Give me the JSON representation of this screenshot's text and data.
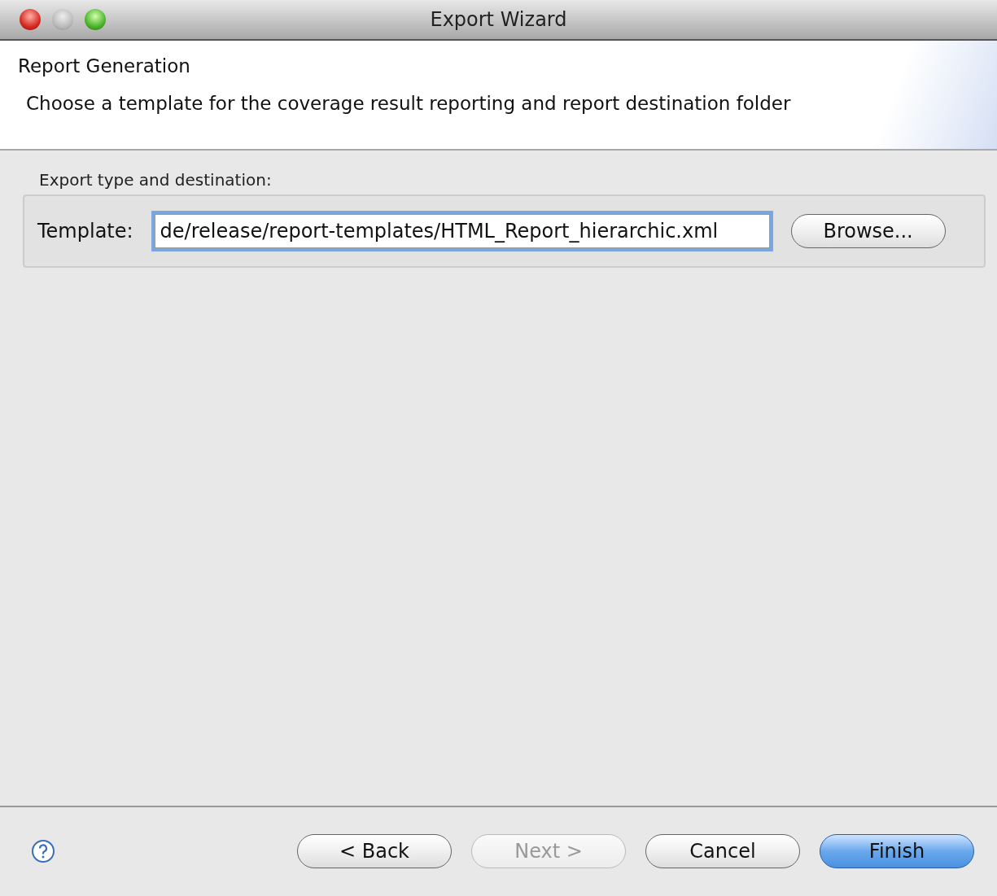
{
  "window": {
    "title": "Export Wizard"
  },
  "header": {
    "title": "Report Generation",
    "description": "Choose a template for the coverage result reporting and report destination folder"
  },
  "group": {
    "label": "Export type and destination:",
    "field_label": "Template:",
    "value": "de/release/report-templates/HTML_Report_hierarchic.xml",
    "focused": true,
    "browse_button": "Browse..."
  },
  "buttons": [
    {
      "label": "< Back",
      "disabled": false,
      "default": false
    },
    {
      "label": "Next >",
      "disabled": true,
      "default": false
    },
    {
      "label": "Cancel",
      "disabled": false,
      "default": false
    },
    {
      "label": "Finish",
      "disabled": false,
      "default": true
    }
  ]
}
